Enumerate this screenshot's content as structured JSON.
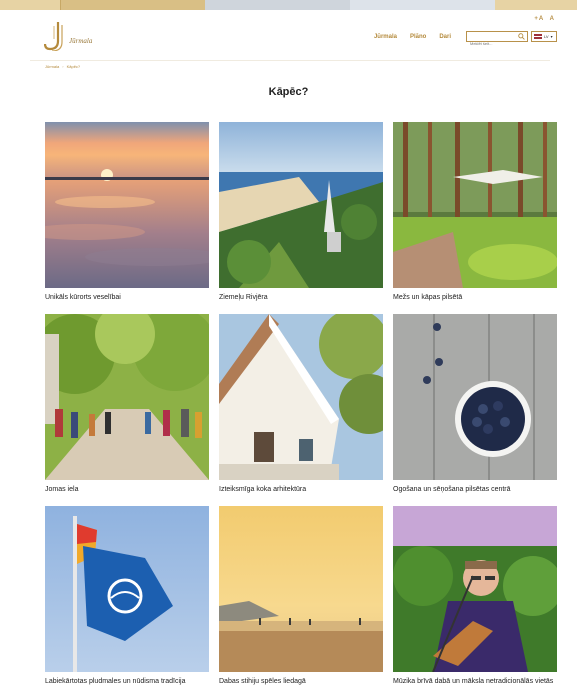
{
  "font_size_control": {
    "increase": "+A",
    "decrease": "A"
  },
  "logo": {
    "text": "Jūrmala"
  },
  "nav": {
    "items": [
      "Jūrmala",
      "Plāno",
      "Dari"
    ]
  },
  "search": {
    "placeholder": "Meklēt šeit..."
  },
  "language": {
    "selected": "LV"
  },
  "breadcrumb": {
    "items": [
      "Jūrmala",
      "Kāpēc?"
    ]
  },
  "page": {
    "title": "Kāpēc?"
  },
  "cards": [
    {
      "caption": "Unikāls kūrorts veselībai",
      "image": "sunset-sea-photo"
    },
    {
      "caption": "Ziemeļu Rivjēra",
      "image": "coast-aerial-photo"
    },
    {
      "caption": "Mežs un kāpas pilsētā",
      "image": "forest-park-photo"
    },
    {
      "caption": "Jomas iela",
      "image": "street-crowd-photo"
    },
    {
      "caption": "Izteiksmīga koka arhitektūra",
      "image": "wooden-house-photo"
    },
    {
      "caption": "Ogošana un sēņošana pilsētas centrā",
      "image": "blueberries-photo"
    },
    {
      "caption": "Labiekārtotas pludmales un nūdisma tradīcija",
      "image": "blue-flag-photo"
    },
    {
      "caption": "Dabas stihiju spēles liedagā",
      "image": "beach-sunset-photo"
    },
    {
      "caption": "Mūzika brīvā dabā un māksla netradicionālās vietās",
      "image": "musician-photo"
    }
  ],
  "colors": {
    "accent": "#b48a3c",
    "text": "#222222",
    "background": "#ffffff"
  }
}
